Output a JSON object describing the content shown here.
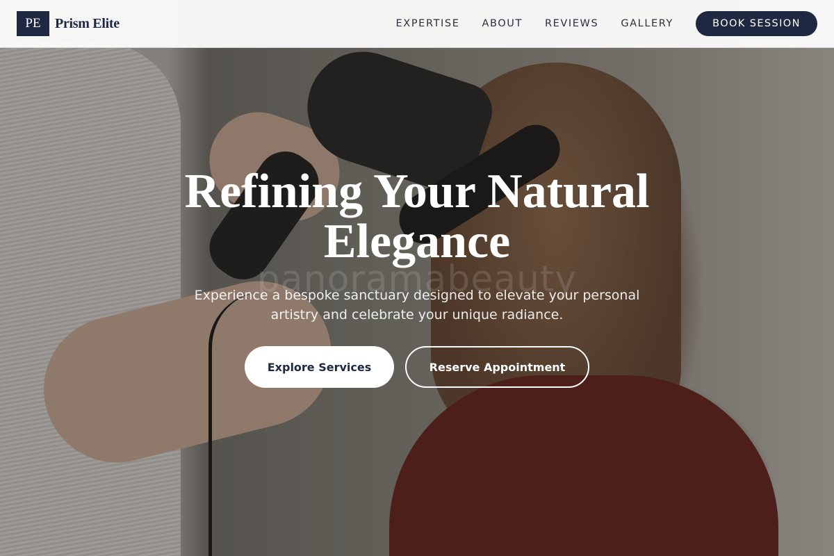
{
  "brand": {
    "mark": "PE",
    "name": "Prism Elite"
  },
  "nav": {
    "links": [
      "EXPERTISE",
      "ABOUT",
      "REVIEWS",
      "GALLERY"
    ],
    "cta_label": "BOOK SESSION"
  },
  "hero": {
    "headline_line1": "Refining Your Natural",
    "headline_line2": "Elegance",
    "subheadline_line1": "Experience a bespoke sanctuary designed to elevate your personal",
    "subheadline_line2": "artistry and celebrate your unique radiance.",
    "primary_button": "Explore Services",
    "secondary_button": "Reserve Appointment",
    "background_watermark": "panoramabeauty"
  },
  "colors": {
    "brand_navy": "#1e2840",
    "nav_background": "#ffffff",
    "hero_text": "#ffffff"
  }
}
